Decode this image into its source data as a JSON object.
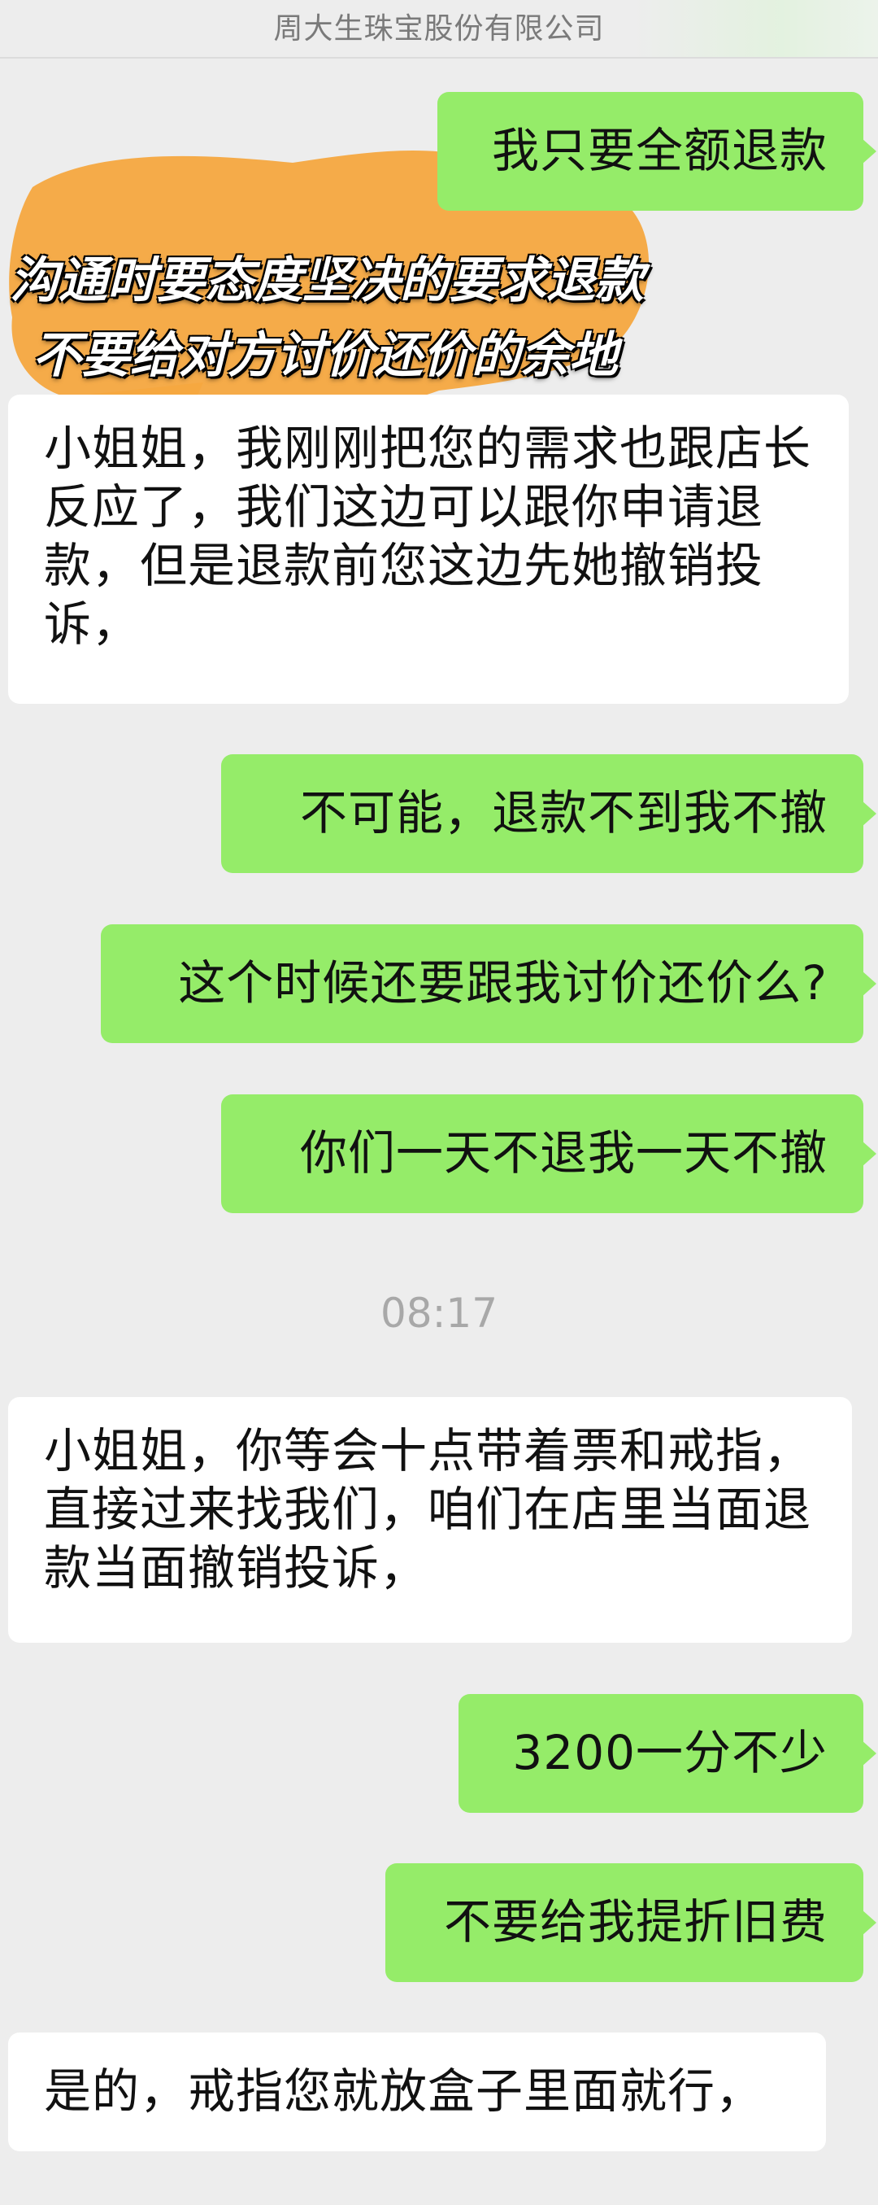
{
  "header": {
    "title": "周大生珠宝股份有限公司"
  },
  "messages": [
    {
      "side": "self",
      "text": "我只要全额退款"
    },
    {
      "side": "other",
      "text": "小姐姐，我刚刚把您的需求也跟店长反应了，我们这边可以跟你申请退款，但是退款前您这边先她撤销投诉，"
    },
    {
      "side": "self",
      "text": "不可能，退款不到我不撤"
    },
    {
      "side": "self",
      "text": "这个时候还要跟我讨价还价么?"
    },
    {
      "side": "self",
      "text": "你们一天不退我一天不撤"
    },
    {
      "side": "other",
      "text": "小姐姐，你等会十点带着票和戒指，直接过来找我们，咱们在店里当面退款当面撤销投诉，"
    },
    {
      "side": "self",
      "text": "3200一分不少"
    },
    {
      "side": "self",
      "text": "不要给我提折旧费"
    },
    {
      "side": "other",
      "text": "是的，戒指您就放盒子里面就行，"
    }
  ],
  "timestamp": "08:17",
  "overlay": {
    "line1": "沟通时要态度坚决的要求退款",
    "line2": "不要给对方讨价还价的余地"
  },
  "colors": {
    "self_bubble": "#95ec69",
    "other_bubble": "#ffffff",
    "background": "#ededed",
    "highlight": "#f5a840"
  }
}
